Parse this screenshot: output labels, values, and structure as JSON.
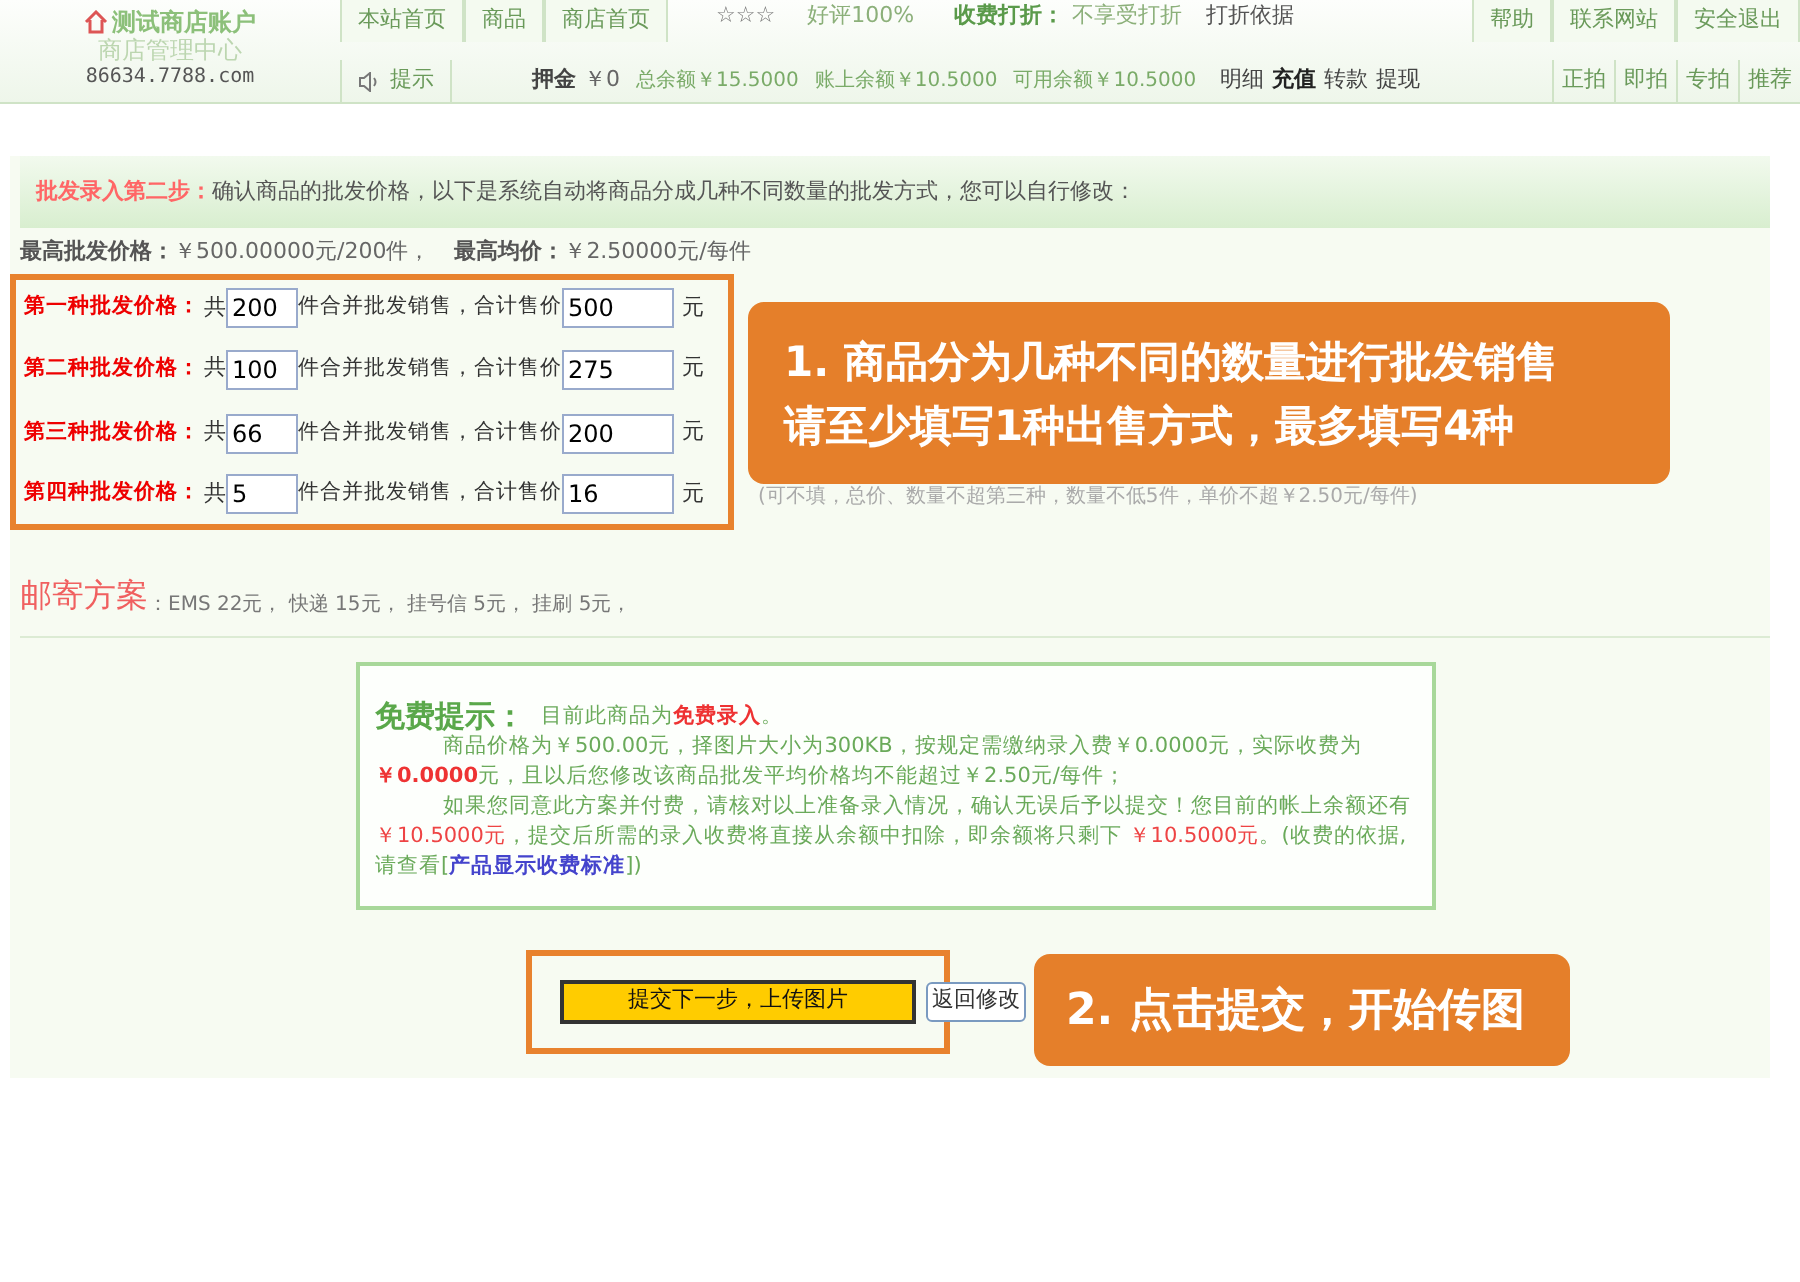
{
  "header": {
    "shop_name": "测试商店账户",
    "subtitle": "商店管理中心",
    "domain": "86634.7788.com",
    "nav_tabs": [
      {
        "label": "本站首页"
      },
      {
        "label": "商品"
      },
      {
        "label": "商店首页"
      }
    ],
    "rating_stars": "☆☆☆",
    "praise": "好评100%",
    "discount_label": "收费打折：",
    "discount_value": "不享受打折",
    "discount_basis": "打折依据",
    "right_links": [
      {
        "label": "帮助"
      },
      {
        "label": "联系网站"
      },
      {
        "label": "安全退出"
      }
    ],
    "tip": "提示",
    "deposit_label": "押金",
    "deposit_value": "￥0",
    "balances": [
      "总余额￥15.5000",
      "账上余额￥10.5000",
      "可用余额￥10.5000"
    ],
    "account_links": [
      {
        "label": "明细",
        "bold": false
      },
      {
        "label": "充值",
        "bold": true
      },
      {
        "label": "转款",
        "bold": false
      },
      {
        "label": "提现",
        "bold": false
      }
    ],
    "auction_links": [
      {
        "label": "正拍"
      },
      {
        "label": "即拍"
      },
      {
        "label": "专拍"
      },
      {
        "label": "推荐"
      }
    ]
  },
  "step": {
    "label": "批发录入第二步：",
    "text": "确认商品的批发价格，以下是系统自动将商品分成几种不同数量的批发方式，您可以自行修改："
  },
  "max_price": {
    "label": "最高批发价格：",
    "value": "￥500.00000元/200件，",
    "avg_label": "最高均价：",
    "avg_value": "￥2.50000元/每件"
  },
  "price_rows": [
    {
      "label": "第一种批发价格：",
      "prefix": "共",
      "quantity": "200",
      "middle": "件合并批发销售，合计售价",
      "total": "500",
      "unit": "元"
    },
    {
      "label": "第二种批发价格：",
      "prefix": "共",
      "quantity": "100",
      "middle": "件合并批发销售，合计售价",
      "total": "275",
      "unit": "元"
    },
    {
      "label": "第三种批发价格：",
      "prefix": "共",
      "quantity": "66",
      "middle": "件合并批发销售，合计售价",
      "total": "200",
      "unit": "元"
    },
    {
      "label": "第四种批发价格：",
      "prefix": "共",
      "quantity": "5",
      "middle": "件合并批发销售，合计售价",
      "total": "16",
      "unit": "元",
      "hint": "(可不填，总价、数量不超第三种，数量不低5件，单价不超￥2.50元/每件)"
    }
  ],
  "shipping": {
    "label": "邮寄方案",
    "text": "：EMS 22元， 快递 15元， 挂号信 5元， 挂刷 5元，"
  },
  "fee_notice": {
    "title": "免费提示：",
    "intro": "目前此商品为**免费录入**。",
    "paragraph_1": "商品价格为￥500.00元，择图片大小为300KB，按规定需缴纳录入费￥0.0000元，实际收费为**￥0.0000**元，且以后您修改该商品批发平均价格均不能超过￥2.50元/每件；",
    "paragraph_2_start": "如果您同意此方案并付费，请核对以上准备录入情况，确认无误后予以提交！您目前的帐上余额还有",
    "paragraph_2_amount": "￥10.5000元",
    "paragraph_2_middle": "，提交后所需的录入收费将直接从余额中扣除，即余额将只剩下",
    "paragraph_2_remaining": "￥10.5000元",
    "paragraph_2_end": "。(收费的依据,请查看[",
    "link": "产品显示收费标准",
    "paragraph_2_close": "])"
  },
  "buttons": [
    {
      "label": "提交下一步，上传图片",
      "kind": "primary"
    },
    {
      "label": "返回修改",
      "kind": "secondary"
    }
  ],
  "callouts": [
    {
      "lines": [
        "1. 商品分为几种不同的数量进行批发销售",
        "请至少填写1种出售方式，最多填写4种"
      ]
    },
    {
      "lines": [
        "2. 点击提交，开始传图"
      ]
    }
  ]
}
